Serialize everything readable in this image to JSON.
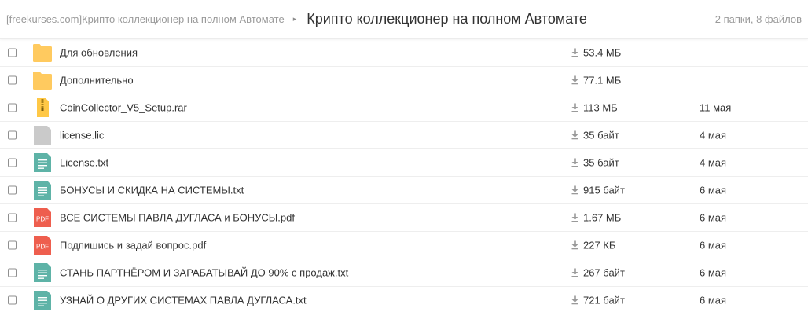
{
  "header": {
    "parent_crumb": "[freekurses.com]Крипто коллекционер на полном Автомате",
    "separator": "▸",
    "current_folder": "Крипто коллекционер на полном Автомате",
    "summary": "2 папки, 8 файлов"
  },
  "colors": {
    "folder": "#FFCA5F",
    "archive": "#FFC846",
    "generic_file": "#CACACA",
    "text_file": "#5EB3A7",
    "pdf": "#EE5E4E"
  },
  "files": [
    {
      "icon": "folder-icon",
      "name": "Для обновления",
      "size": "53.4 МБ",
      "date": ""
    },
    {
      "icon": "folder-icon",
      "name": "Дополнительно",
      "size": "77.1 МБ",
      "date": ""
    },
    {
      "icon": "archive-icon",
      "name": "CoinCollector_V5_Setup.rar",
      "size": "113 МБ",
      "date": "11 мая"
    },
    {
      "icon": "file-icon",
      "name": "license.lic",
      "size": "35 байт",
      "date": "4 мая"
    },
    {
      "icon": "text-file-icon",
      "name": "License.txt",
      "size": "35 байт",
      "date": "4 мая"
    },
    {
      "icon": "text-file-icon",
      "name": "БОНУСЫ И СКИДКА НА СИСТЕМЫ.txt",
      "size": "915 байт",
      "date": "6 мая"
    },
    {
      "icon": "pdf-icon",
      "name": "ВСЕ СИСТЕМЫ ПАВЛА ДУГЛАСА и БОНУСЫ.pdf",
      "size": "1.67 МБ",
      "date": "6 мая"
    },
    {
      "icon": "pdf-icon",
      "name": "Подпишись и задай вопрос.pdf",
      "size": "227 КБ",
      "date": "6 мая"
    },
    {
      "icon": "text-file-icon",
      "name": "СТАНЬ ПАРТНЁРОМ И ЗАРАБАТЫВАЙ ДО 90% с продаж.txt",
      "size": "267 байт",
      "date": "6 мая"
    },
    {
      "icon": "text-file-icon",
      "name": "УЗНАЙ О ДРУГИХ СИСТЕМАХ ПАВЛА ДУГЛАСА.txt",
      "size": "721 байт",
      "date": "6 мая"
    }
  ],
  "pdf_badge": "PDF"
}
